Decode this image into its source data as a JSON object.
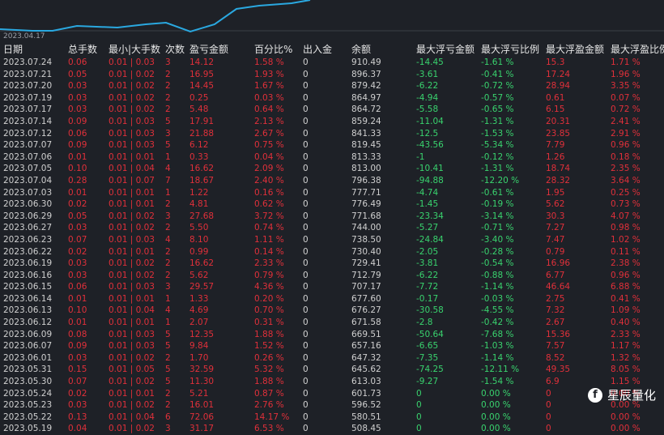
{
  "chart": {
    "start_date": "2023.04.17",
    "line_color": "#2aa8e0"
  },
  "columns": [
    "日期",
    "总手数",
    "最小|大手数",
    "次数",
    "盈亏金额",
    "百分比%",
    "出入金",
    "余额",
    "最大浮亏金额",
    "最大浮亏比例",
    "最大浮盈金额",
    "最大浮盈比例"
  ],
  "rows": [
    [
      "2023.07.24",
      "0.06",
      "0.01 | 0.03",
      "3",
      "14.12",
      "1.58 %",
      "0",
      "910.49",
      "-14.45",
      "-1.61 %",
      "15.3",
      "1.71 %"
    ],
    [
      "2023.07.21",
      "0.05",
      "0.01 | 0.02",
      "2",
      "16.95",
      "1.93 %",
      "0",
      "896.37",
      "-3.61",
      "-0.41 %",
      "17.24",
      "1.96 %"
    ],
    [
      "2023.07.20",
      "0.03",
      "0.01 | 0.02",
      "2",
      "14.45",
      "1.67 %",
      "0",
      "879.42",
      "-6.22",
      "-0.72 %",
      "28.94",
      "3.35 %"
    ],
    [
      "2023.07.19",
      "0.03",
      "0.01 | 0.02",
      "2",
      "0.25",
      "0.03 %",
      "0",
      "864.97",
      "-4.94",
      "-0.57 %",
      "0.61",
      "0.07 %"
    ],
    [
      "2023.07.17",
      "0.03",
      "0.01 | 0.02",
      "2",
      "5.48",
      "0.64 %",
      "0",
      "864.72",
      "-5.58",
      "-0.65 %",
      "6.15",
      "0.72 %"
    ],
    [
      "2023.07.14",
      "0.09",
      "0.01 | 0.03",
      "5",
      "17.91",
      "2.13 %",
      "0",
      "859.24",
      "-11.04",
      "-1.31 %",
      "20.31",
      "2.41 %"
    ],
    [
      "2023.07.12",
      "0.06",
      "0.01 | 0.03",
      "3",
      "21.88",
      "2.67 %",
      "0",
      "841.33",
      "-12.5",
      "-1.53 %",
      "23.85",
      "2.91 %"
    ],
    [
      "2023.07.07",
      "0.09",
      "0.01 | 0.03",
      "5",
      "6.12",
      "0.75 %",
      "0",
      "819.45",
      "-43.56",
      "-5.34 %",
      "7.79",
      "0.96 %"
    ],
    [
      "2023.07.06",
      "0.01",
      "0.01 | 0.01",
      "1",
      "0.33",
      "0.04 %",
      "0",
      "813.33",
      "-1",
      "-0.12 %",
      "1.26",
      "0.18 %"
    ],
    [
      "2023.07.05",
      "0.10",
      "0.01 | 0.04",
      "4",
      "16.62",
      "2.09 %",
      "0",
      "813.00",
      "-10.41",
      "-1.31 %",
      "18.74",
      "2.35 %"
    ],
    [
      "2023.07.04",
      "0.28",
      "0.01 | 0.07",
      "7",
      "18.67",
      "2.40 %",
      "0",
      "796.38",
      "-94.88",
      "-12.20 %",
      "28.32",
      "3.64 %"
    ],
    [
      "2023.07.03",
      "0.01",
      "0.01 | 0.01",
      "1",
      "1.22",
      "0.16 %",
      "0",
      "777.71",
      "-4.74",
      "-0.61 %",
      "1.95",
      "0.25 %"
    ],
    [
      "2023.06.30",
      "0.02",
      "0.01 | 0.01",
      "2",
      "4.81",
      "0.62 %",
      "0",
      "776.49",
      "-1.45",
      "-0.19 %",
      "5.62",
      "0.73 %"
    ],
    [
      "2023.06.29",
      "0.05",
      "0.01 | 0.02",
      "3",
      "27.68",
      "3.72 %",
      "0",
      "771.68",
      "-23.34",
      "-3.14 %",
      "30.3",
      "4.07 %"
    ],
    [
      "2023.06.27",
      "0.03",
      "0.01 | 0.02",
      "2",
      "5.50",
      "0.74 %",
      "0",
      "744.00",
      "-5.27",
      "-0.71 %",
      "7.27",
      "0.98 %"
    ],
    [
      "2023.06.23",
      "0.07",
      "0.01 | 0.03",
      "4",
      "8.10",
      "1.11 %",
      "0",
      "738.50",
      "-24.84",
      "-3.40 %",
      "7.47",
      "1.02 %"
    ],
    [
      "2023.06.22",
      "0.02",
      "0.01 | 0.01",
      "2",
      "0.99",
      "0.14 %",
      "0",
      "730.40",
      "-2.05",
      "-0.28 %",
      "0.79",
      "0.11 %"
    ],
    [
      "2023.06.19",
      "0.03",
      "0.01 | 0.02",
      "2",
      "16.62",
      "2.33 %",
      "0",
      "729.41",
      "-3.81",
      "-0.54 %",
      "16.96",
      "2.38 %"
    ],
    [
      "2023.06.16",
      "0.03",
      "0.01 | 0.02",
      "2",
      "5.62",
      "0.79 %",
      "0",
      "712.79",
      "-6.22",
      "-0.88 %",
      "6.77",
      "0.96 %"
    ],
    [
      "2023.06.15",
      "0.06",
      "0.01 | 0.03",
      "3",
      "29.57",
      "4.36 %",
      "0",
      "707.17",
      "-7.72",
      "-1.14 %",
      "46.64",
      "6.88 %"
    ],
    [
      "2023.06.14",
      "0.01",
      "0.01 | 0.01",
      "1",
      "1.33",
      "0.20 %",
      "0",
      "677.60",
      "-0.17",
      "-0.03 %",
      "2.75",
      "0.41 %"
    ],
    [
      "2023.06.13",
      "0.10",
      "0.01 | 0.04",
      "4",
      "4.69",
      "0.70 %",
      "0",
      "676.27",
      "-30.58",
      "-4.55 %",
      "7.32",
      "1.09 %"
    ],
    [
      "2023.06.12",
      "0.01",
      "0.01 | 0.01",
      "1",
      "2.07",
      "0.31 %",
      "0",
      "671.58",
      "-2.8",
      "-0.42 %",
      "2.67",
      "0.40 %"
    ],
    [
      "2023.06.09",
      "0.08",
      "0.01 | 0.03",
      "5",
      "12.35",
      "1.88 %",
      "0",
      "669.51",
      "-50.64",
      "-7.68 %",
      "15.36",
      "2.33 %"
    ],
    [
      "2023.06.07",
      "0.09",
      "0.01 | 0.03",
      "5",
      "9.84",
      "1.52 %",
      "0",
      "657.16",
      "-6.65",
      "-1.03 %",
      "7.57",
      "1.17 %"
    ],
    [
      "2023.06.01",
      "0.03",
      "0.01 | 0.02",
      "2",
      "1.70",
      "0.26 %",
      "0",
      "647.32",
      "-7.35",
      "-1.14 %",
      "8.52",
      "1.32 %"
    ],
    [
      "2023.05.31",
      "0.15",
      "0.01 | 0.05",
      "5",
      "32.59",
      "5.32 %",
      "0",
      "645.62",
      "-74.25",
      "-12.11 %",
      "49.35",
      "8.05 %"
    ],
    [
      "2023.05.30",
      "0.07",
      "0.01 | 0.02",
      "5",
      "11.30",
      "1.88 %",
      "0",
      "613.03",
      "-9.27",
      "-1.54 %",
      "6.9",
      "1.15 %"
    ],
    [
      "2023.05.24",
      "0.02",
      "0.01 | 0.01",
      "2",
      "5.21",
      "0.87 %",
      "0",
      "601.73",
      "0",
      "0.00 %",
      "0",
      "0.00 %"
    ],
    [
      "2023.05.23",
      "0.03",
      "0.01 | 0.02",
      "2",
      "16.01",
      "2.76 %",
      "0",
      "596.52",
      "0",
      "0.00 %",
      "0",
      "0.00 %"
    ],
    [
      "2023.05.22",
      "0.13",
      "0.01 | 0.04",
      "6",
      "72.06",
      "14.17 %",
      "0",
      "580.51",
      "0",
      "0.00 %",
      "0",
      "0.00 %"
    ],
    [
      "2023.05.19",
      "0.04",
      "0.01 | 0.02",
      "3",
      "31.17",
      "6.53 %",
      "0",
      "508.45",
      "0",
      "0.00 %",
      "0",
      "0.00 %"
    ]
  ],
  "watermark": {
    "text": "星辰量化",
    "icon": "facebook-icon",
    "icon_glyph": "f"
  }
}
